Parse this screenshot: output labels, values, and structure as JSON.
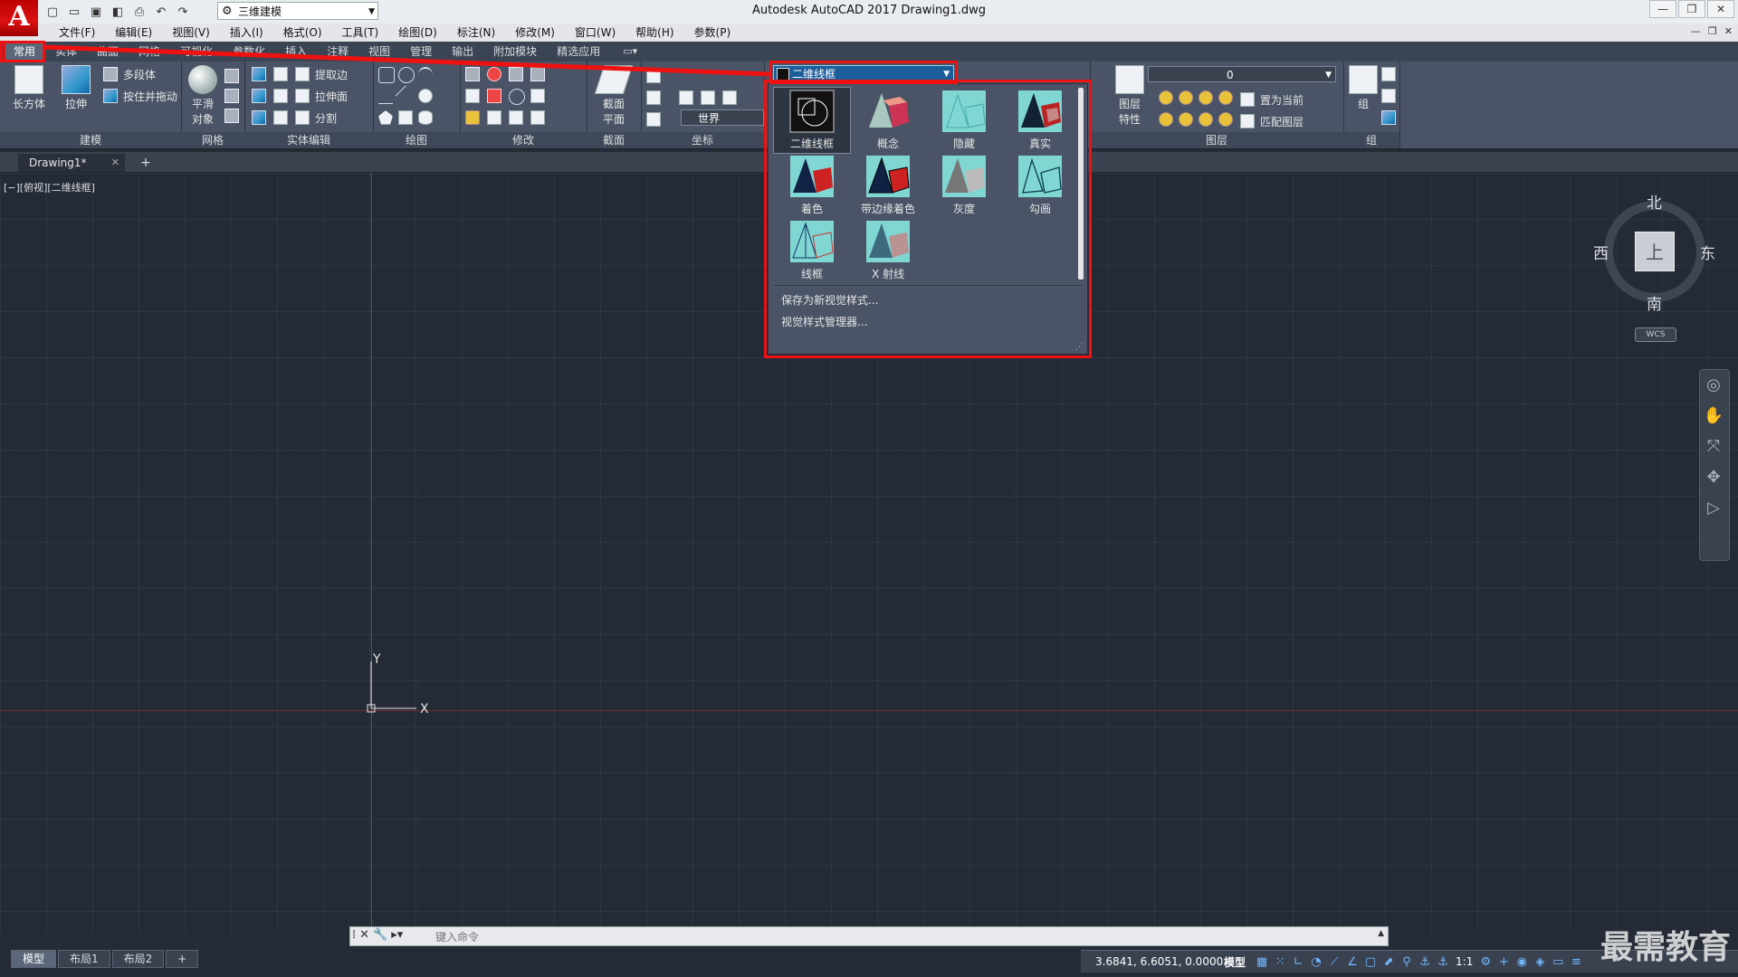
{
  "titlebar": {
    "title": "Autodesk AutoCAD 2017     Drawing1.dwg",
    "workspace": "三维建模",
    "logo": "A"
  },
  "menubar": {
    "items": [
      "文件(F)",
      "编辑(E)",
      "视图(V)",
      "插入(I)",
      "格式(O)",
      "工具(T)",
      "绘图(D)",
      "标注(N)",
      "修改(M)",
      "窗口(W)",
      "帮助(H)",
      "参数(P)"
    ]
  },
  "ribbon": {
    "tabs": [
      "常用",
      "实体",
      "曲面",
      "网格",
      "可视化",
      "参数化",
      "插入",
      "注释",
      "视图",
      "管理",
      "输出",
      "附加模块",
      "精选应用"
    ],
    "active_tab": "常用",
    "panels": {
      "modeling": {
        "title": "建模",
        "box": "长方体",
        "extrude": "拉伸",
        "polysolid": "多段体",
        "presspull": "按住并拖动"
      },
      "mesh": {
        "title": "网格",
        "smooth1": "平滑",
        "smooth2": "对象"
      },
      "solid_edit": {
        "title": "实体编辑",
        "extract": "提取边",
        "extrude_face": "拉伸面",
        "split": "分割"
      },
      "draw": {
        "title": "绘图"
      },
      "modify": {
        "title": "修改"
      },
      "section": {
        "title": "截面",
        "label1": "截面",
        "label2": "平面"
      },
      "coordinates": {
        "title": "坐标",
        "ucs": "世界"
      },
      "layers": {
        "title": "图层",
        "props1": "图层",
        "props2": "特性",
        "layer_value": "0",
        "set_current": "置为当前",
        "match": "匹配图层"
      },
      "groups": {
        "title": "组",
        "group": "组"
      }
    }
  },
  "visual_style": {
    "current": "二维线框",
    "options": [
      {
        "label": "二维线框",
        "icon": "2d-wireframe"
      },
      {
        "label": "概念",
        "icon": "conceptual"
      },
      {
        "label": "隐藏",
        "icon": "hidden"
      },
      {
        "label": "真实",
        "icon": "realistic"
      },
      {
        "label": "着色",
        "icon": "shaded"
      },
      {
        "label": "带边缘着色",
        "icon": "shaded-edges"
      },
      {
        "label": "灰度",
        "icon": "shades-of-gray"
      },
      {
        "label": "勾画",
        "icon": "sketchy"
      },
      {
        "label": "线框",
        "icon": "wireframe"
      },
      {
        "label": "X 射线",
        "icon": "x-ray"
      }
    ],
    "save_as_new": "保存为新视觉样式...",
    "manager": "视觉样式管理器..."
  },
  "file_tabs": {
    "current": "Drawing1*"
  },
  "viewport": {
    "label": "[−][俯视][二维线框]",
    "axis_x": "X",
    "axis_y": "Y"
  },
  "viewcube": {
    "north": "北",
    "south": "南",
    "east": "东",
    "west": "西",
    "face": "上",
    "wcs": "WCS"
  },
  "command": {
    "placeholder": "键入命令"
  },
  "layouts": [
    "模型",
    "布局1",
    "布局2"
  ],
  "status": {
    "coords": "3.6841, 6.6051, 0.0000",
    "model": "模型",
    "scale": "1:1"
  },
  "watermark": "最需教育",
  "colors": {
    "accent_red": "#e11111",
    "combo_blue": "#1b5e9c",
    "ribbon_bg": "#4a5466",
    "canvas_bg": "#252b36"
  }
}
